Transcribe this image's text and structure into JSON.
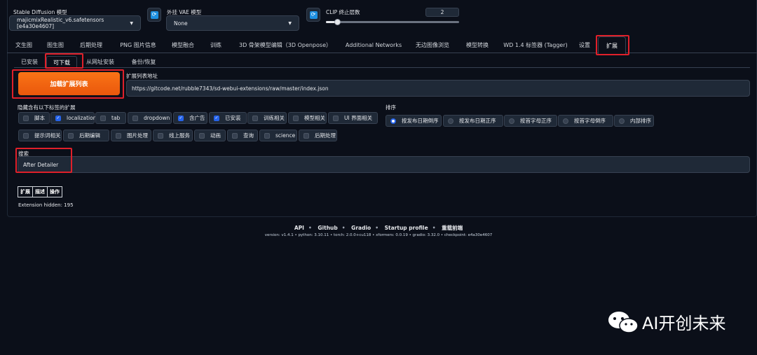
{
  "header": {
    "sd_model_label": "Stable Diffusion 模型",
    "sd_model_value": "majicmixRealistic_v6.safetensors [e4a30e4607]",
    "vae_label": "外挂 VAE 模型",
    "vae_value": "None",
    "clip_label": "CLIP 终止层数",
    "clip_value": "2",
    "clip_fraction": 0.083
  },
  "tabs": [
    {
      "label": "文生图"
    },
    {
      "label": "图生图"
    },
    {
      "label": "后期处理"
    },
    {
      "label": "PNG 图片信息"
    },
    {
      "label": "模型融合"
    },
    {
      "label": "训练"
    },
    {
      "label": "3D 骨架模型编辑（3D Openpose）"
    },
    {
      "label": "Additional Networks"
    },
    {
      "label": "无边图像浏览"
    },
    {
      "label": "模型转换"
    },
    {
      "label": "WD 1.4 标签器 (Tagger)"
    },
    {
      "label": "设置"
    },
    {
      "label": "扩展"
    }
  ],
  "subtabs": [
    {
      "label": "已安装"
    },
    {
      "label": "可下载"
    },
    {
      "label": "从网址安装"
    },
    {
      "label": "备份/恢复"
    }
  ],
  "load_button": "加载扩展列表",
  "url_label": "扩展列表地址",
  "url_value": "https://gitcode.net/rubble7343/sd-webui-extensions/raw/master/index.json",
  "hide_label": "隐藏含有以下标签的扩展",
  "hide_tags": [
    {
      "label": "脚本",
      "checked": false
    },
    {
      "label": "localization",
      "checked": true
    },
    {
      "label": "tab",
      "checked": false
    },
    {
      "label": "dropdown",
      "checked": false
    },
    {
      "label": "含广告",
      "checked": true
    },
    {
      "label": "已安装",
      "checked": true
    },
    {
      "label": "训练相关",
      "checked": false
    },
    {
      "label": "模型相关",
      "checked": false
    },
    {
      "label": "UI 界面相关",
      "checked": false
    },
    {
      "label": "提示词相关",
      "checked": false
    },
    {
      "label": "后期编辑",
      "checked": false
    },
    {
      "label": "图片处理",
      "checked": false
    },
    {
      "label": "线上服务",
      "checked": false
    },
    {
      "label": "动画",
      "checked": false
    },
    {
      "label": "查询",
      "checked": false
    },
    {
      "label": "science",
      "checked": false
    },
    {
      "label": "后期处理",
      "checked": false
    }
  ],
  "sort_label": "排序",
  "sort_options": [
    {
      "label": "按发布日期倒序",
      "selected": true
    },
    {
      "label": "按发布日期正序",
      "selected": false
    },
    {
      "label": "按首字母正序",
      "selected": false
    },
    {
      "label": "按首字母倒序",
      "selected": false
    },
    {
      "label": "内部排序",
      "selected": false
    }
  ],
  "search_label": "搜索",
  "search_value": "After Detailer",
  "table_headers": [
    "扩展",
    "描述",
    "操作"
  ],
  "hidden_text": "Extension hidden: 195",
  "footer": {
    "links": [
      "API",
      "Github",
      "Gradio",
      "Startup profile",
      "重载前端"
    ],
    "version": "version: v1.4.1  •  python: 3.10.11  •  torch: 2.0.0+cu118  •  xformers: 0.0.19  •  gradio: 3.32.0  •  checkpoint: e4a30e4607"
  },
  "watermark": "AI开创未来",
  "colors": {
    "accent": "#ea580c",
    "highlight": "#e0202a",
    "check": "#2563eb",
    "bg": "#0b0f19"
  }
}
